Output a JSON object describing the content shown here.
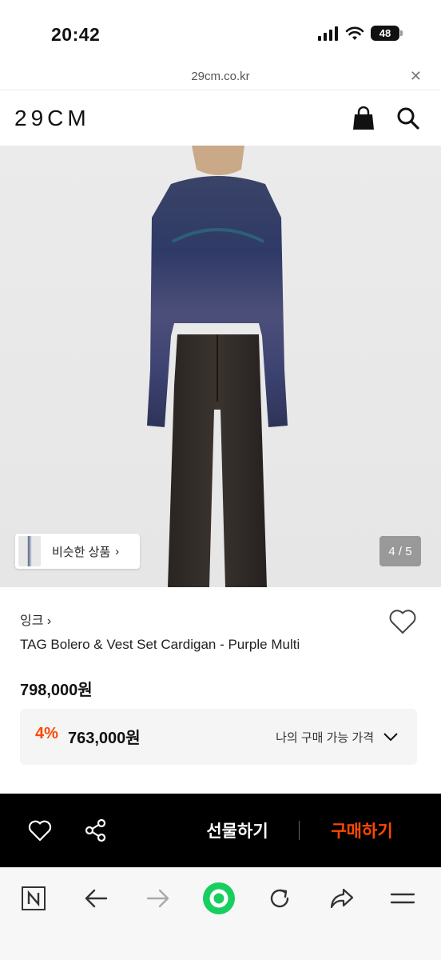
{
  "status": {
    "time": "20:42",
    "battery": "48"
  },
  "url": {
    "domain": "29cm.co.kr",
    "close_icon": "close-icon"
  },
  "header": {
    "logo": "29CM",
    "icons": [
      "shopping-bag-icon",
      "search-icon"
    ]
  },
  "gallery": {
    "similar_label": "비슷한 상품",
    "similar_chevron": "›",
    "counter": "4 / 5"
  },
  "product": {
    "brand": "잉크 ›",
    "name": "TAG Bolero & Vest Set Cardigan - Purple Multi",
    "price": "798,000원",
    "discount": "4%",
    "sale_price": "763,000원",
    "price_label": "나의 구매 가능 가격"
  },
  "actions": {
    "gift_label": "선물하기",
    "buy_label": "구매하기"
  },
  "colors": {
    "accent": "#ff4800",
    "action_bar": "#000000",
    "browser_green": "#19ce60"
  },
  "browser_toolbar": {
    "items": [
      "naver-n-icon",
      "back-arrow-icon",
      "forward-arrow-icon",
      "green-home-icon",
      "refresh-icon",
      "share-arrow-icon",
      "menu-icon"
    ]
  }
}
